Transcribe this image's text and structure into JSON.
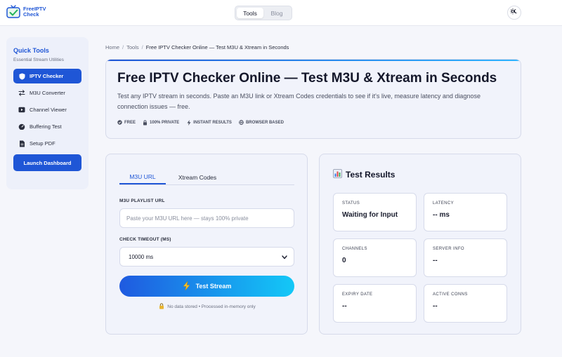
{
  "app": {
    "logo_line1": "FreeIPTV",
    "logo_line2": "Check",
    "brand_color": "#1f56d6"
  },
  "nav": {
    "tabs": [
      {
        "label": "Tools",
        "active": true
      },
      {
        "label": "Blog",
        "active": false
      }
    ],
    "theme_toggle_icon": "sun-moon-icon"
  },
  "sidebar": {
    "title": "Quick Tools",
    "subtitle": "Essential Stream Utilities",
    "items": [
      {
        "label": "IPTV Checker",
        "icon": "shield-icon",
        "active": true
      },
      {
        "label": "M3U Converter",
        "icon": "swap-arrows-icon",
        "active": false
      },
      {
        "label": "Channel Viewer",
        "icon": "play-screen-icon",
        "active": false
      },
      {
        "label": "Buffering Test",
        "icon": "gauge-icon",
        "active": false
      },
      {
        "label": "Setup PDF",
        "icon": "document-icon",
        "active": false
      }
    ],
    "launch_label": "Launch Dashboard"
  },
  "breadcrumb": {
    "home": "Home",
    "tools": "Tools",
    "current": "Free IPTV Checker Online — Test M3U & Xtream in Seconds"
  },
  "hero": {
    "title": "Free IPTV Checker Online — Test M3U & Xtream in Seconds",
    "description": "Test any IPTV stream in seconds. Paste an M3U link or Xtream Codes credentials to see if it's live, measure latency and diagnose connection issues — free.",
    "tags": [
      {
        "label": "FREE",
        "icon": "check-badge-icon"
      },
      {
        "label": "100% PRIVATE",
        "icon": "lock-icon"
      },
      {
        "label": "INSTANT RESULTS",
        "icon": "lightning-icon"
      },
      {
        "label": "BROWSER BASED",
        "icon": "globe-icon"
      }
    ]
  },
  "checker": {
    "tabs": [
      {
        "label": "M3U URL",
        "active": true
      },
      {
        "label": "Xtream Codes",
        "active": false
      }
    ],
    "url_label": "M3U PLAYLIST URL",
    "url_placeholder": "Paste your M3U URL here — stays 100% private",
    "url_value": "",
    "timeout_label": "CHECK TIMEOUT (MS)",
    "timeout_value": "10000 ms",
    "test_button": "Test Stream",
    "test_button_icon": "lightning-icon",
    "note": "No data stored • Processed in-memory only",
    "note_icon": "lock-icon"
  },
  "results": {
    "title": "Test Results",
    "title_icon": "bar-chart-icon",
    "cells": [
      {
        "label": "STATUS",
        "value": "Waiting for Input"
      },
      {
        "label": "LATENCY",
        "value": "-- ms"
      },
      {
        "label": "CHANNELS",
        "value": "0"
      },
      {
        "label": "SERVER INFO",
        "value": "--"
      },
      {
        "label": "EXPIRY DATE",
        "value": "--"
      },
      {
        "label": "ACTIVE CONNS",
        "value": "--"
      }
    ]
  }
}
